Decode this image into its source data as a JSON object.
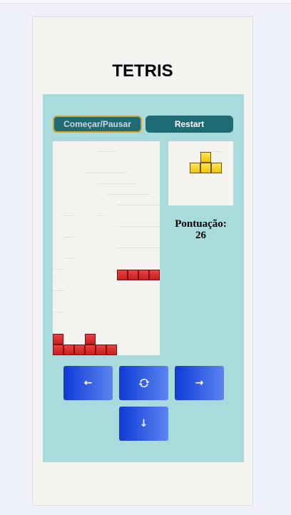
{
  "title": "TETRIS",
  "buttons": {
    "start_pause": "Começar/Pausar",
    "restart": "Restart"
  },
  "score": {
    "label": "Pontuação:",
    "value": "26"
  },
  "controls": {
    "left": "←",
    "rotate": "🔄",
    "right": "→",
    "down": "↓"
  },
  "colors": {
    "panel": "#a9dadc",
    "button": "#1f6b73",
    "start_border": "#d6a132",
    "piece_red": "#e13232",
    "piece_yellow": "#f9d423",
    "control_blue": "#2a55e0"
  },
  "board": {
    "cols": 10,
    "rows": 20,
    "cells": [
      {
        "col": 6,
        "row": 12,
        "color": "red"
      },
      {
        "col": 7,
        "row": 12,
        "color": "red"
      },
      {
        "col": 8,
        "row": 12,
        "color": "red"
      },
      {
        "col": 9,
        "row": 12,
        "color": "red"
      },
      {
        "col": 0,
        "row": 18,
        "color": "red"
      },
      {
        "col": 3,
        "row": 18,
        "color": "red"
      },
      {
        "col": 0,
        "row": 19,
        "color": "red"
      },
      {
        "col": 1,
        "row": 19,
        "color": "red"
      },
      {
        "col": 2,
        "row": 19,
        "color": "red"
      },
      {
        "col": 3,
        "row": 19,
        "color": "red"
      },
      {
        "col": 4,
        "row": 19,
        "color": "red"
      },
      {
        "col": 5,
        "row": 19,
        "color": "red"
      }
    ]
  },
  "next_piece": {
    "type": "T",
    "color": "yellow",
    "cells": [
      {
        "col": 3,
        "row": 1
      },
      {
        "col": 2,
        "row": 2
      },
      {
        "col": 3,
        "row": 2
      },
      {
        "col": 4,
        "row": 2
      }
    ]
  }
}
